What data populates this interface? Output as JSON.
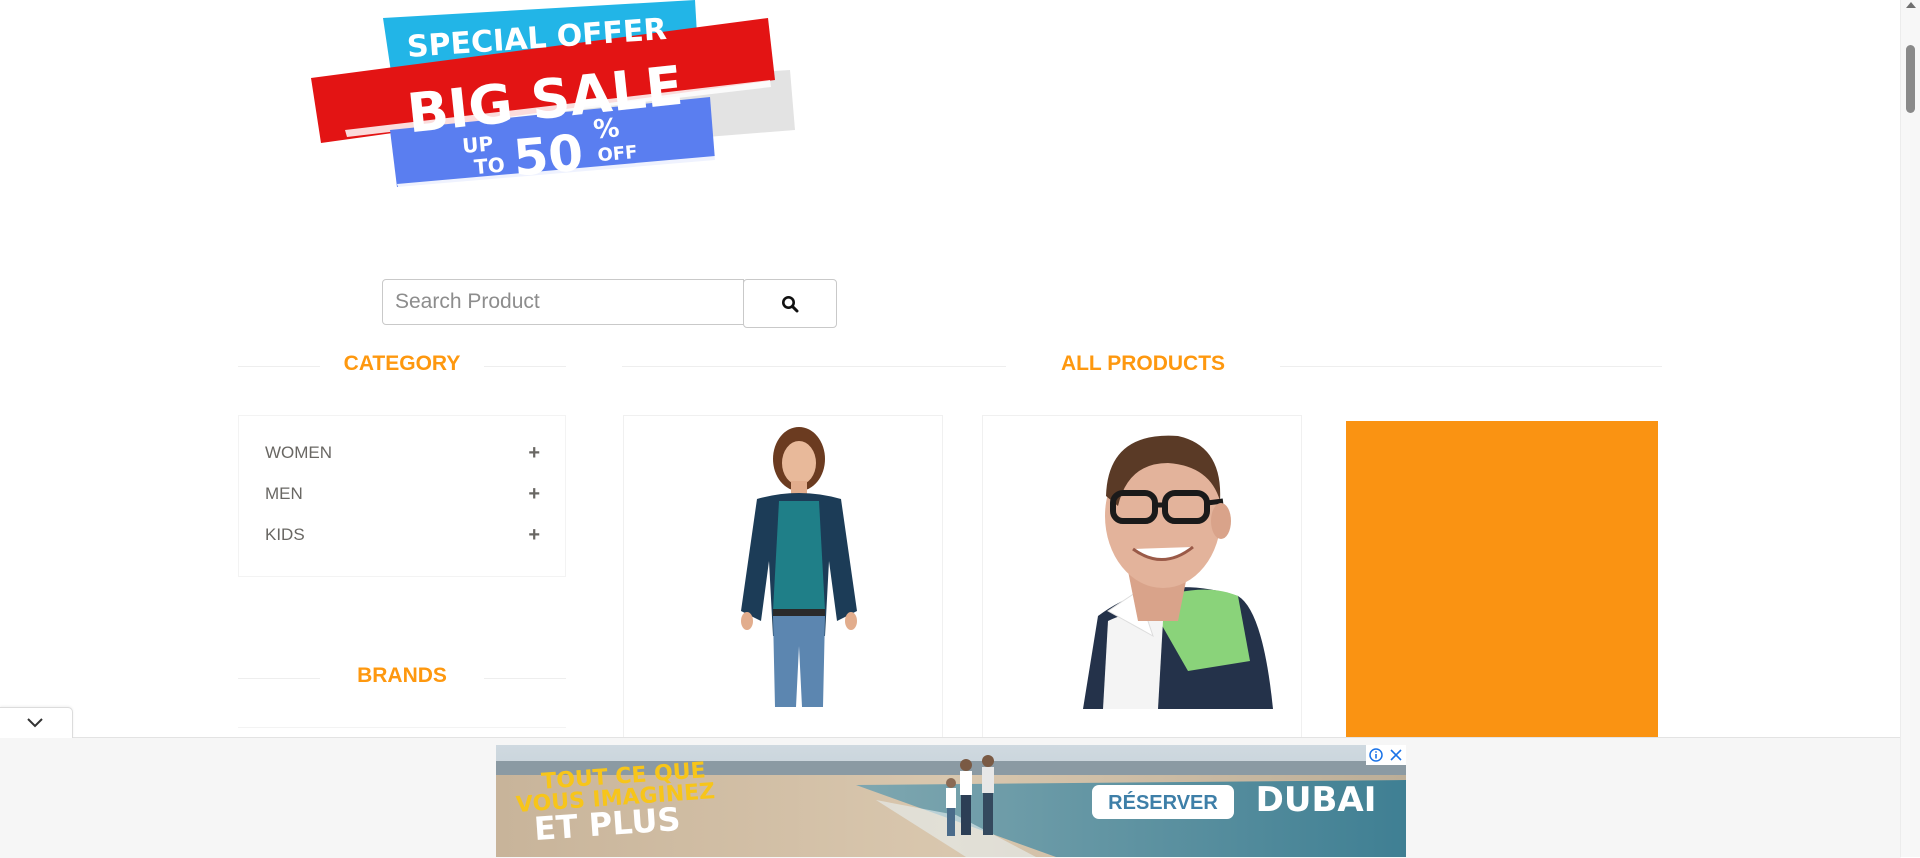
{
  "logo": {
    "line1": "SPECIAL OFFER",
    "line2": "BIG SALE",
    "line3_up": "UP",
    "line3_to": "TO",
    "line3_number": "50",
    "line3_percent": "%",
    "line3_off": "OFF"
  },
  "search": {
    "placeholder": "Search Product",
    "icon": "search-icon"
  },
  "sidebar": {
    "category_title": "CATEGORY",
    "categories": [
      {
        "label": "WOMEN",
        "icon": "plus-icon"
      },
      {
        "label": "MEN",
        "icon": "plus-icon"
      },
      {
        "label": "KIDS",
        "icon": "plus-icon"
      }
    ],
    "brands_title": "BRANDS"
  },
  "main": {
    "title": "ALL PRODUCTS",
    "products": [
      {
        "image": "woman-model"
      },
      {
        "image": "man-with-glasses"
      },
      {
        "image": "orange-placeholder"
      }
    ]
  },
  "ad": {
    "text1": "TOUT CE QUE",
    "text2": "VOUS IMAGINEZ",
    "text3": "ET PLUS",
    "button": "RÉSERVER",
    "brand": "DUBAI"
  },
  "colors": {
    "accent": "#fe980f",
    "logo_blue": "#22b5e7",
    "logo_red": "#e31414",
    "logo_navy": "#5a7ef0",
    "product_orange": "#fa9312"
  }
}
